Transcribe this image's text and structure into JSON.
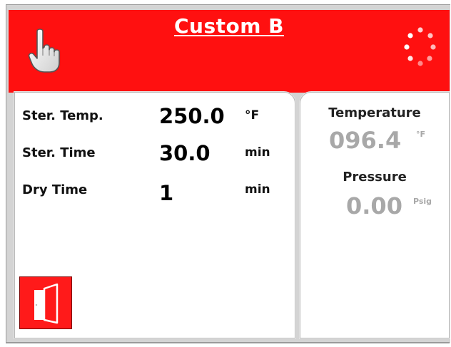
{
  "header": {
    "title": "Custom B",
    "hand_icon": "pointing-hand-icon",
    "status_icon": "loading-spinner-icon"
  },
  "parameters": {
    "items": [
      {
        "label": "Ster. Temp.",
        "value": "250.0",
        "unit": "°F"
      },
      {
        "label": "Ster. Time",
        "value": "30.0",
        "unit": "min"
      },
      {
        "label": "Dry Time",
        "value": "1",
        "unit": "min"
      }
    ]
  },
  "readings": {
    "temperature_label": "Temperature",
    "temperature_value": "096.4",
    "temperature_unit": "°F",
    "pressure_label": "Pressure",
    "pressure_value": "0.00",
    "pressure_unit": "Psig"
  },
  "door_button": {
    "icon": "door-icon"
  },
  "colors": {
    "header_red": "#ff1010",
    "reading_gray": "#a8a8a8"
  }
}
